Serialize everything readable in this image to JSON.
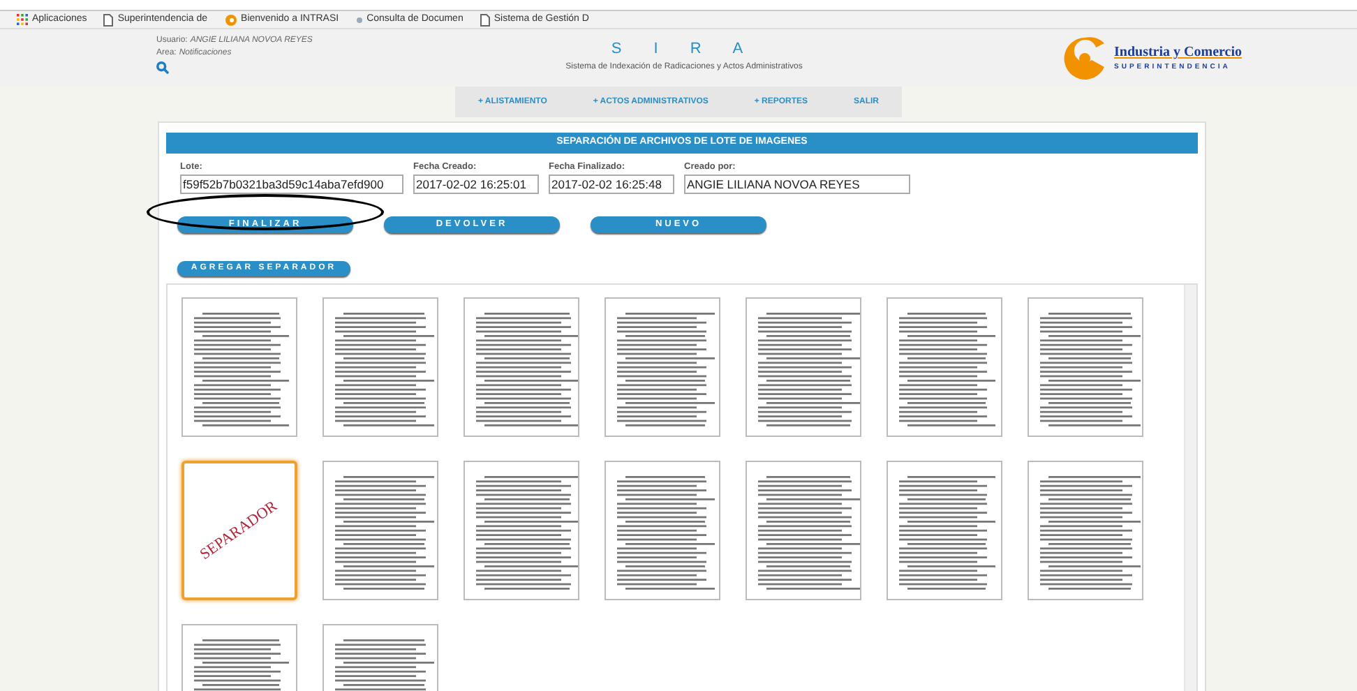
{
  "bookmarks": [
    {
      "label": "Aplicaciones",
      "kind": "apps"
    },
    {
      "label": "Superintendencia de",
      "kind": "page"
    },
    {
      "label": "Bienvenido a INTRASI",
      "kind": "logo"
    },
    {
      "label": "Consulta de Documen",
      "kind": "dot"
    },
    {
      "label": "Sistema de Gestión D",
      "kind": "page"
    }
  ],
  "header": {
    "user_label": "Usuario:",
    "user": "ANGIE LILIANA NOVOA REYES",
    "area_label": "Area:",
    "area": "Notificaciones",
    "app_name": "S I R A",
    "app_subtitle": "Sistema de Indexación de Radicaciones y Actos Administrativos",
    "logo_title": "Industria y Comercio",
    "logo_subtitle": "SUPERINTENDENCIA"
  },
  "nav": [
    "+ ALISTAMIENTO",
    "+ ACTOS ADMINISTRATIVOS",
    "+ REPORTES",
    "SALIR"
  ],
  "panel": {
    "title": "SEPARACIÓN DE ARCHIVOS DE LOTE DE IMAGENES",
    "fields": [
      {
        "label": "Lote:",
        "value": "f59f52b7b0321ba3d59c14aba7efd900"
      },
      {
        "label": "Fecha Creado:",
        "value": "2017-02-02 16:25:01"
      },
      {
        "label": "Fecha Finalizado:",
        "value": "2017-02-02 16:25:48"
      },
      {
        "label": "Creado por:",
        "value": "ANGIE LILIANA NOVOA REYES"
      }
    ],
    "buttons": [
      {
        "label": "FINALIZAR",
        "circled": true
      },
      {
        "label": "DEVOLVER",
        "circled": false
      },
      {
        "label": "NUEVO",
        "circled": false
      }
    ],
    "add_button": "AGREGAR SEPARADOR"
  },
  "thumbnails": [
    {
      "kind": "page",
      "selected": false
    },
    {
      "kind": "page",
      "selected": false
    },
    {
      "kind": "page",
      "selected": false
    },
    {
      "kind": "page",
      "selected": false
    },
    {
      "kind": "page",
      "selected": false
    },
    {
      "kind": "page",
      "selected": false
    },
    {
      "kind": "page",
      "selected": false
    },
    {
      "kind": "separator",
      "label": "SEPARADOR",
      "selected": true
    },
    {
      "kind": "page",
      "selected": false
    },
    {
      "kind": "page",
      "selected": false
    },
    {
      "kind": "page",
      "selected": false
    },
    {
      "kind": "page",
      "selected": false
    },
    {
      "kind": "page",
      "selected": false
    },
    {
      "kind": "page",
      "selected": false
    },
    {
      "kind": "page",
      "selected": false
    },
    {
      "kind": "page",
      "selected": false
    }
  ]
}
